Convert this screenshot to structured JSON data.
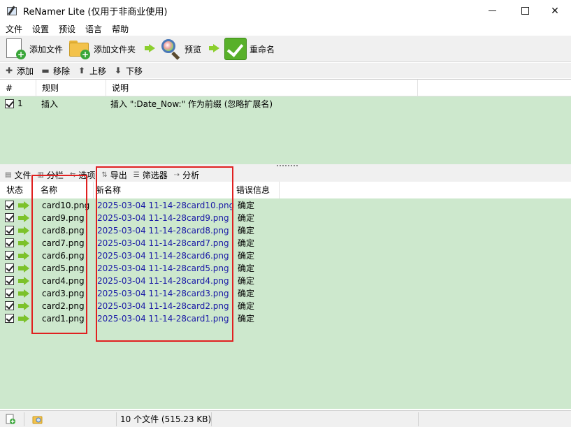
{
  "window": {
    "title": "ReNamer Lite (仅用于非商业使用)"
  },
  "menu": [
    "文件",
    "设置",
    "预设",
    "语言",
    "帮助"
  ],
  "toolbar": {
    "add_files": "添加文件",
    "add_folder": "添加文件夹",
    "preview": "预览",
    "rename": "重命名"
  },
  "rule_toolbar": {
    "add": "添加",
    "remove": "移除",
    "up": "上移",
    "down": "下移"
  },
  "rules_table": {
    "headers": {
      "num": "#",
      "rule": "规则",
      "desc": "说明"
    },
    "rows": [
      {
        "num": "1",
        "rule": "插入",
        "desc": "插入 \":Date_Now:\" 作为前缀 (忽略扩展名)",
        "checked": true
      }
    ]
  },
  "file_toolbar": {
    "files": "文件",
    "columns": "分栏",
    "options": "选项",
    "export": "导出",
    "filter": "筛选器",
    "analyze": "分析"
  },
  "files_table": {
    "headers": {
      "state": "状态",
      "name": "名称",
      "new_name": "新名称",
      "error": "错误信息"
    },
    "rows": [
      {
        "name": "card10.png",
        "new_name": "2025-03-04 11-14-28card10.png",
        "error": "确定"
      },
      {
        "name": "card9.png",
        "new_name": "2025-03-04 11-14-28card9.png",
        "error": "确定"
      },
      {
        "name": "card8.png",
        "new_name": "2025-03-04 11-14-28card8.png",
        "error": "确定"
      },
      {
        "name": "card7.png",
        "new_name": "2025-03-04 11-14-28card7.png",
        "error": "确定"
      },
      {
        "name": "card6.png",
        "new_name": "2025-03-04 11-14-28card6.png",
        "error": "确定"
      },
      {
        "name": "card5.png",
        "new_name": "2025-03-04 11-14-28card5.png",
        "error": "确定"
      },
      {
        "name": "card4.png",
        "new_name": "2025-03-04 11-14-28card4.png",
        "error": "确定"
      },
      {
        "name": "card3.png",
        "new_name": "2025-03-04 11-14-28card3.png",
        "error": "确定"
      },
      {
        "name": "card2.png",
        "new_name": "2025-03-04 11-14-28card2.png",
        "error": "确定"
      },
      {
        "name": "card1.png",
        "new_name": "2025-03-04 11-14-28card1.png",
        "error": "确定"
      }
    ]
  },
  "status": {
    "summary": "10 个文件 (515.23 KB)"
  },
  "colors": {
    "row_bg": "#cde8cd",
    "new_name_text": "#1a1aa6",
    "highlight": "#e02020",
    "accent_green": "#58b02a"
  }
}
